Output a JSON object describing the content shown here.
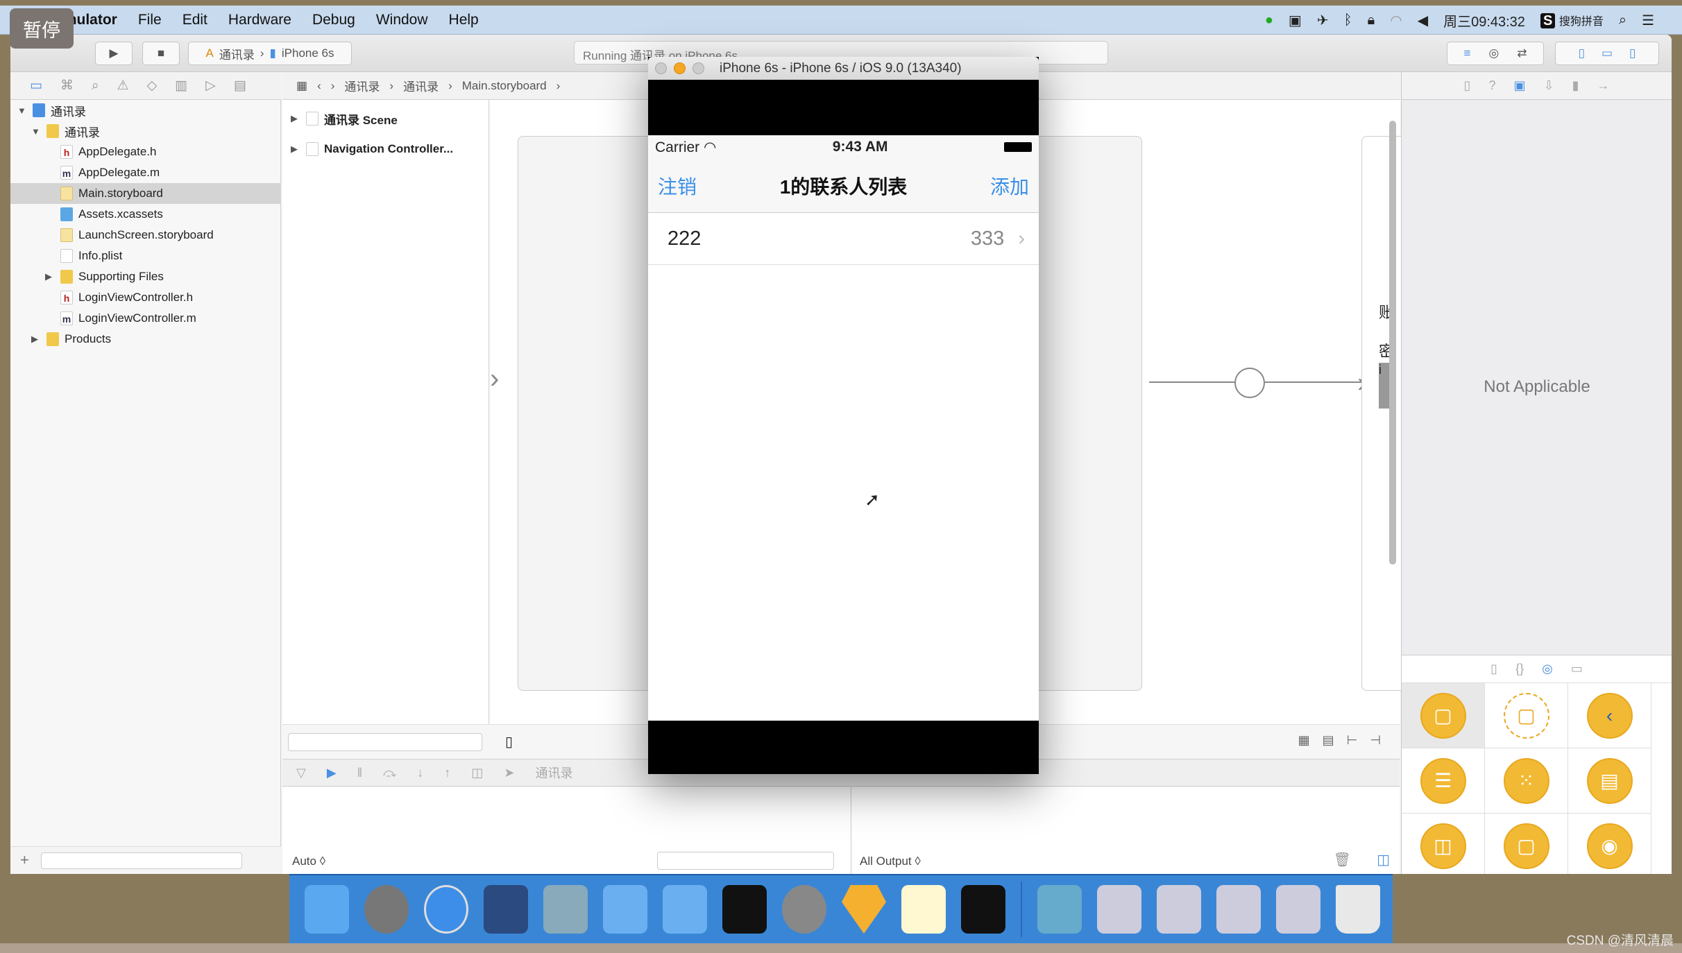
{
  "menubar": {
    "app": "Simulator",
    "items": [
      "File",
      "Edit",
      "Hardware",
      "Debug",
      "Window",
      "Help"
    ],
    "clock": "周三09:43:32",
    "input_method": "搜狗拼音"
  },
  "overlay": {
    "pause": "暂停"
  },
  "toolbar": {
    "scheme": "通讯录",
    "device": "iPhone 6s",
    "activity": "Running 通讯录 on iPhone 6s"
  },
  "jumpbar": [
    "通讯录",
    "通讯录",
    "Main.storyboard"
  ],
  "navigator": {
    "items": [
      {
        "label": "通讯录",
        "type": "project",
        "level": 0,
        "expanded": true
      },
      {
        "label": "通讯录",
        "type": "folder",
        "level": 1,
        "expanded": true
      },
      {
        "label": "AppDelegate.h",
        "type": "h"
      },
      {
        "label": "AppDelegate.m",
        "type": "m"
      },
      {
        "label": "Main.storyboard",
        "type": "storyboard",
        "selected": true
      },
      {
        "label": "Assets.xcassets",
        "type": "assets"
      },
      {
        "label": "LaunchScreen.storyboard",
        "type": "storyboard"
      },
      {
        "label": "Info.plist",
        "type": "plist"
      },
      {
        "label": "Supporting Files",
        "type": "folder",
        "collapsed": true
      },
      {
        "label": "LoginViewController.h",
        "type": "h"
      },
      {
        "label": "LoginViewController.m",
        "type": "m"
      },
      {
        "label": "Products",
        "type": "folder",
        "level": 1,
        "collapsed": true
      }
    ]
  },
  "outline": {
    "items": [
      "通讯录 Scene",
      "Navigation Controller..."
    ]
  },
  "canvas": {
    "partial_labels": [
      "账",
      "密",
      "i"
    ]
  },
  "debug": {
    "scheme_label": "通讯录",
    "variables_mode": "Auto ◊",
    "console_mode": "All Output ◊"
  },
  "inspector": {
    "message": "Not Applicable"
  },
  "simulator": {
    "title": "iPhone 6s - iPhone 6s / iOS 9.0 (13A340)",
    "status": {
      "carrier": "Carrier",
      "time": "9:43 AM"
    },
    "nav": {
      "left": "注销",
      "title": "1的联系人列表",
      "right": "添加"
    },
    "rows": [
      {
        "title": "222",
        "detail": "333"
      }
    ],
    "accent": "#3a8fe8"
  },
  "watermark": "CSDN @清风清晨"
}
